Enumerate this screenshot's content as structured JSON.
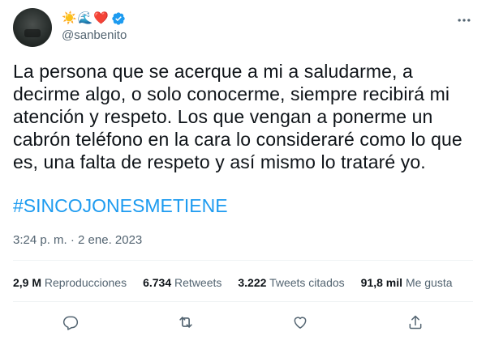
{
  "author": {
    "name_emojis": [
      "☀️",
      "🌊",
      "❤️"
    ],
    "verified_icon": "verified-badge-icon",
    "handle": "@sanbenito"
  },
  "tweet": {
    "text": "La persona que se acerque a mi a saludarme, a decirme algo, o solo conocerme, siempre recibirá mi atención y respeto. Los que vengan a ponerme un cabrón teléfono en la cara lo consideraré como lo que es, una falta de respeto y así mismo lo trataré yo.",
    "hashtag": "#SINCOJONESMETIENE",
    "timestamp": "3:24 p. m. · 2 ene. 2023"
  },
  "stats": [
    {
      "value": "2,9 M",
      "label": "Reproducciones"
    },
    {
      "value": "6.734",
      "label": "Retweets"
    },
    {
      "value": "3.222",
      "label": "Tweets citados"
    },
    {
      "value": "91,8 mil",
      "label": "Me gusta"
    }
  ],
  "actions": [
    "reply-icon",
    "retweet-icon",
    "like-icon",
    "share-icon"
  ],
  "colors": {
    "accent": "#1d9bf0",
    "secondary_text": "#536471",
    "primary_text": "#0f1419",
    "divider": "#eff3f4"
  }
}
